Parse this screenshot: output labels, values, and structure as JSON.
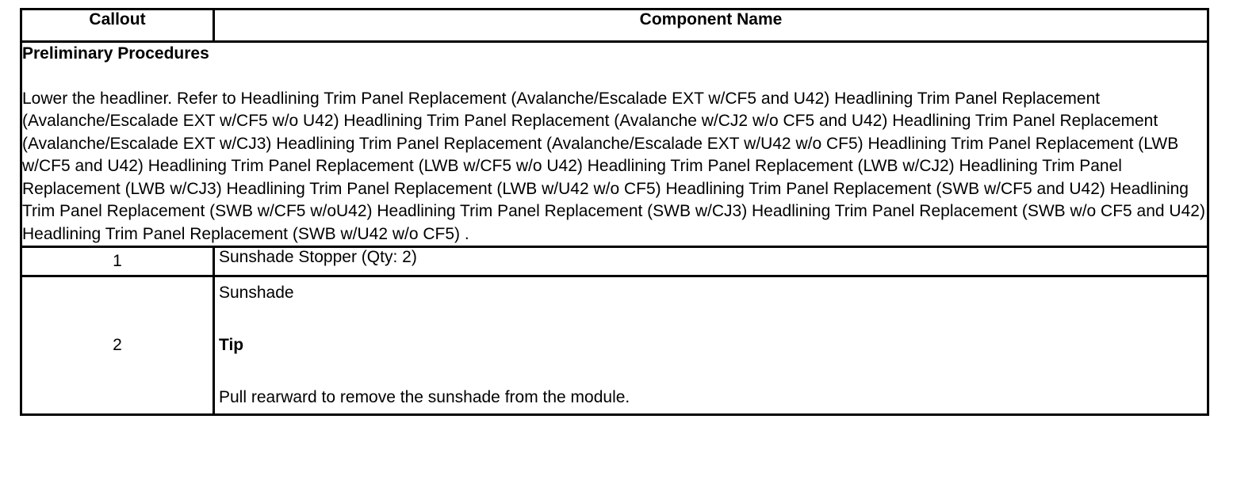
{
  "table": {
    "headers": {
      "callout": "Callout",
      "component_name": "Component Name"
    },
    "preliminary": {
      "heading": "Preliminary Procedures",
      "text": "Lower the headliner. Refer to Headlining Trim Panel Replacement (Avalanche/Escalade EXT w/CF5 and U42) Headlining Trim Panel Replacement (Avalanche/Escalade EXT w/CF5 w/o U42) Headlining Trim Panel Replacement (Avalanche w/CJ2 w/o CF5 and U42) Headlining Trim Panel Replacement (Avalanche/Escalade EXT w/CJ3) Headlining Trim Panel Replacement (Avalanche/Escalade EXT w/U42 w/o CF5) Headlining Trim Panel Replacement (LWB w/CF5 and U42) Headlining Trim Panel Replacement (LWB w/CF5 w/o U42) Headlining Trim Panel Replacement (LWB w/CJ2) Headlining Trim Panel Replacement (LWB w/CJ3) Headlining Trim Panel Replacement (LWB w/U42 w/o CF5) Headlining Trim Panel Replacement (SWB w/CF5 and U42) Headlining Trim Panel Replacement (SWB w/CF5 w/oU42) Headlining Trim Panel Replacement (SWB w/CJ3) Headlining Trim Panel Replacement (SWB w/o CF5 and U42) Headlining Trim Panel Replacement (SWB w/U42 w/o CF5) ."
    },
    "rows": [
      {
        "callout": "1",
        "component": "Sunshade Stopper (Qty: 2)"
      },
      {
        "callout": "2",
        "component": "Sunshade",
        "tip_label": "Tip",
        "tip_text": "Pull rearward to remove the sunshade from the module."
      }
    ]
  }
}
